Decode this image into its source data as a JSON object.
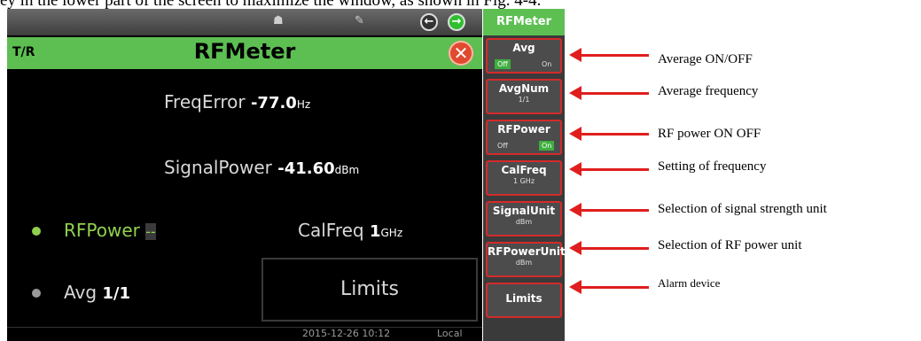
{
  "caption": "ey in the lower part of the screen to maximize the window, as shown in Fig. 4-4.",
  "screen": {
    "mode_label": "T/R",
    "title": "RFMeter",
    "freq_error": {
      "label": "FreqError",
      "value": "-77.0",
      "unit": "Hz"
    },
    "signal_power": {
      "label": "SignalPower",
      "value": "-41.60",
      "unit": "dBm"
    },
    "rf_power": {
      "label": "RFPower",
      "value": "--"
    },
    "cal_freq": {
      "label": "CalFreq",
      "value": "1",
      "unit": "GHz"
    },
    "avg": {
      "label": "Avg",
      "value": "1/1"
    },
    "limits_label": "Limits",
    "status": {
      "datetime": "2015-12-26 10:12",
      "mode": "Local"
    }
  },
  "panel": {
    "title": "RFMeter",
    "keys": [
      {
        "label": "Avg",
        "off": "Off",
        "on": "On"
      },
      {
        "label": "AvgNum",
        "sub": "1/1"
      },
      {
        "label": "RFPower",
        "off": "Off",
        "on": "On"
      },
      {
        "label": "CalFreq",
        "sub": "1 GHz"
      },
      {
        "label": "SignalUnit",
        "sub": "dBm"
      },
      {
        "label": "RFPowerUnit",
        "sub": "dBm"
      },
      {
        "label": "Limits"
      }
    ]
  },
  "annotations": [
    "Average ON/OFF",
    "Average frequency",
    "RF power ON OFF",
    "Setting of frequency",
    "Selection of signal strength unit",
    "Selection of RF power unit",
    "Alarm device"
  ],
  "colors": {
    "accent_green": "#5dbf52",
    "highlight_red": "#d42a2a",
    "value_green": "#8fd14f"
  }
}
